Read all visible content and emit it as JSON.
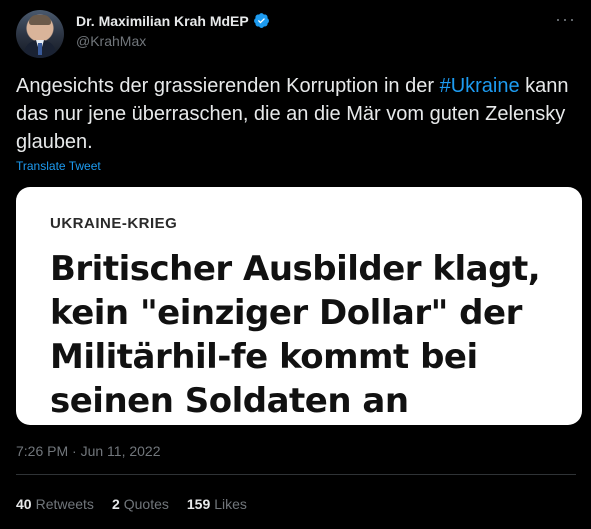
{
  "author": {
    "display_name": "Dr. Maximilian Krah MdEP",
    "handle": "@KrahMax"
  },
  "tweet": {
    "text_before": "Angesichts der grassierenden Korruption in der ",
    "hashtag": "#Ukraine",
    "text_after": " kann das nur jene überraschen, die an die Mär vom guten Zelensky glauben.",
    "translate_label": "Translate Tweet"
  },
  "card": {
    "kicker": "UKRAINE-KRIEG",
    "headline": "Britischer Ausbilder klagt, kein \"einziger Dollar\" der Militärhil-fe kommt bei seinen Soldaten an"
  },
  "timestamp": "7:26 PM · Jun 11, 2022",
  "stats": [
    {
      "count": "40",
      "label": "Retweets"
    },
    {
      "count": "2",
      "label": "Quotes"
    },
    {
      "count": "159",
      "label": "Likes"
    }
  ],
  "icons": {
    "verified": "verified-badge-icon",
    "more": "more-options-icon"
  },
  "colors": {
    "background": "#000000",
    "accent": "#1d9bf0",
    "text": "#e7e9ea",
    "muted": "#71767b"
  }
}
